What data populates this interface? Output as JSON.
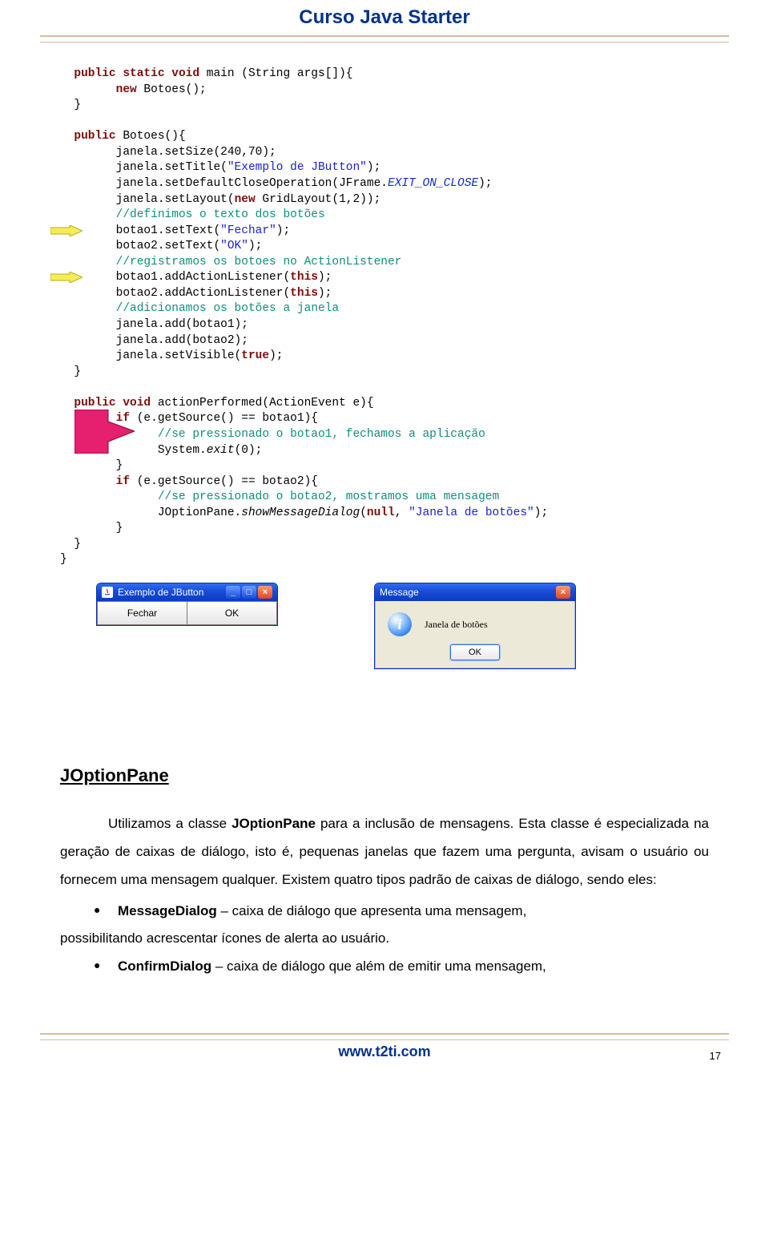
{
  "header": {
    "title": "Curso Java Starter"
  },
  "code": {
    "l1_kw1": "public",
    "l1_kw2": "static",
    "l1_kw3": "void",
    "l1_rest": " main (String args[]){",
    "l2_kw": "new",
    "l2_rest": " Botoes();",
    "l3": "}",
    "l4_kw": "public",
    "l4_rest": " Botoes(){",
    "l5a": "janela.setSize(240,70);",
    "l5b_a": "janela.setTitle(",
    "l5b_str": "\"Exemplo de JButton\"",
    "l5b_b": ");",
    "l5c_a": "janela.setDefaultCloseOperation(JFrame.",
    "l5c_const": "EXIT_ON_CLOSE",
    "l5c_b": ");",
    "l5d_a": "janela.setLayout(",
    "l5d_kw": "new",
    "l5d_b": " GridLayout(1,2));",
    "l6": "//definimos o texto dos botões",
    "l7_a": "botao1.setText(",
    "l7_str": "\"Fechar\"",
    "l7_b": ");",
    "l8_a": "botao2.setText(",
    "l8_str": "\"OK\"",
    "l8_b": ");",
    "l9": "//registramos os botoes no ActionListener",
    "l10_a": "botao1.addActionListener(",
    "l10_kw": "this",
    "l10_b": ");",
    "l11_a": "botao2.addActionListener(",
    "l11_kw": "this",
    "l11_b": ");",
    "l12": "//adicionamos os botões a janela",
    "l13": "janela.add(botao1);",
    "l14": "janela.add(botao2);",
    "l15_a": "janela.setVisible(",
    "l15_kw": "true",
    "l15_b": ");",
    "l16": "}",
    "l17_kw1": "public",
    "l17_kw2": "void",
    "l17_rest": " actionPerformed(ActionEvent e){",
    "l18_kw": "if",
    "l18_rest": " (e.getSource() == botao1){",
    "l19": "//se pressionado o botao1, fechamos a aplicação",
    "l20_a": "System.",
    "l20_it": "exit",
    "l20_b": "(0);",
    "l21": "}",
    "l22_kw": "if",
    "l22_rest": " (e.getSource() == botao2){",
    "l23": "//se pressionado o botao2, mostramos uma mensagem",
    "l24_a": "JOptionPane.",
    "l24_it": "showMessageDialog",
    "l24_b": "(",
    "l24_kw": "null",
    "l24_c": ", ",
    "l24_str": "\"Janela de botões\"",
    "l24_d": ");",
    "l25": "}",
    "l26": "}",
    "l27": "}"
  },
  "window1": {
    "title": "Exemplo de JButton",
    "button1": "Fechar",
    "button2": "OK"
  },
  "window2": {
    "title": "Message",
    "text": "Janela de botões",
    "ok": "OK",
    "icon_mark": "i"
  },
  "section": {
    "title": "JOptionPane",
    "para": "Utilizamos a classe JOptionPane para a inclusão de mensagens. Esta classe é especializada na geração de caixas de diálogo, isto é, pequenas janelas que fazem uma pergunta, avisam o usuário ou fornecem uma mensagem qualquer. Existem quatro tipos padrão de caixas de diálogo, sendo eles:",
    "bold_in_para": "JOptionPane",
    "b1_name": "MessageDialog",
    "b1_text": " – caixa de diálogo que apresenta uma mensagem, possibilitando acrescentar ícones de alerta ao usuário.",
    "b2_name": "ConfirmDialog",
    "b2_text": " – caixa de diálogo que além de emitir uma mensagem,"
  },
  "footer": {
    "url": "www.t2ti.com",
    "page": "17"
  }
}
